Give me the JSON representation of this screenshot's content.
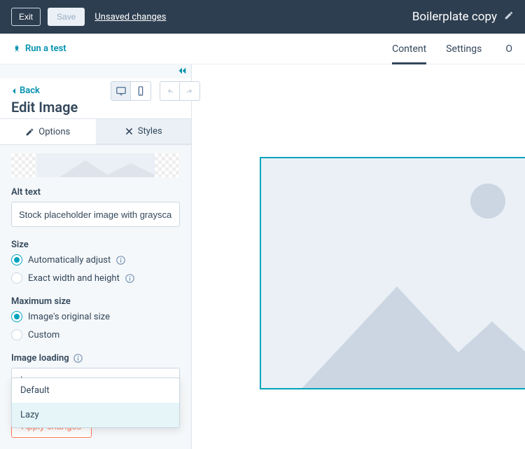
{
  "topbar": {
    "exit": "Exit",
    "save": "Save",
    "unsaved": "Unsaved changes",
    "title": "Boilerplate copy"
  },
  "secondbar": {
    "run_test": "Run a test",
    "tabs": {
      "content": "Content",
      "settings": "Settings",
      "more": "O"
    }
  },
  "panel": {
    "back": "Back",
    "title": "Edit Image",
    "tabs": {
      "options": "Options",
      "styles": "Styles"
    },
    "alt_label": "Alt text",
    "alt_value": "Stock placeholder image with grayscale ge",
    "size_label": "Size",
    "size_options": {
      "auto": "Automatically adjust",
      "exact": "Exact width and height"
    },
    "max_label": "Maximum size",
    "max_options": {
      "original": "Image's original size",
      "custom": "Custom"
    },
    "loading_label": "Image loading",
    "loading_value": "Lazy",
    "dropdown": {
      "default": "Default",
      "lazy": "Lazy"
    },
    "apply": "Apply changes"
  }
}
